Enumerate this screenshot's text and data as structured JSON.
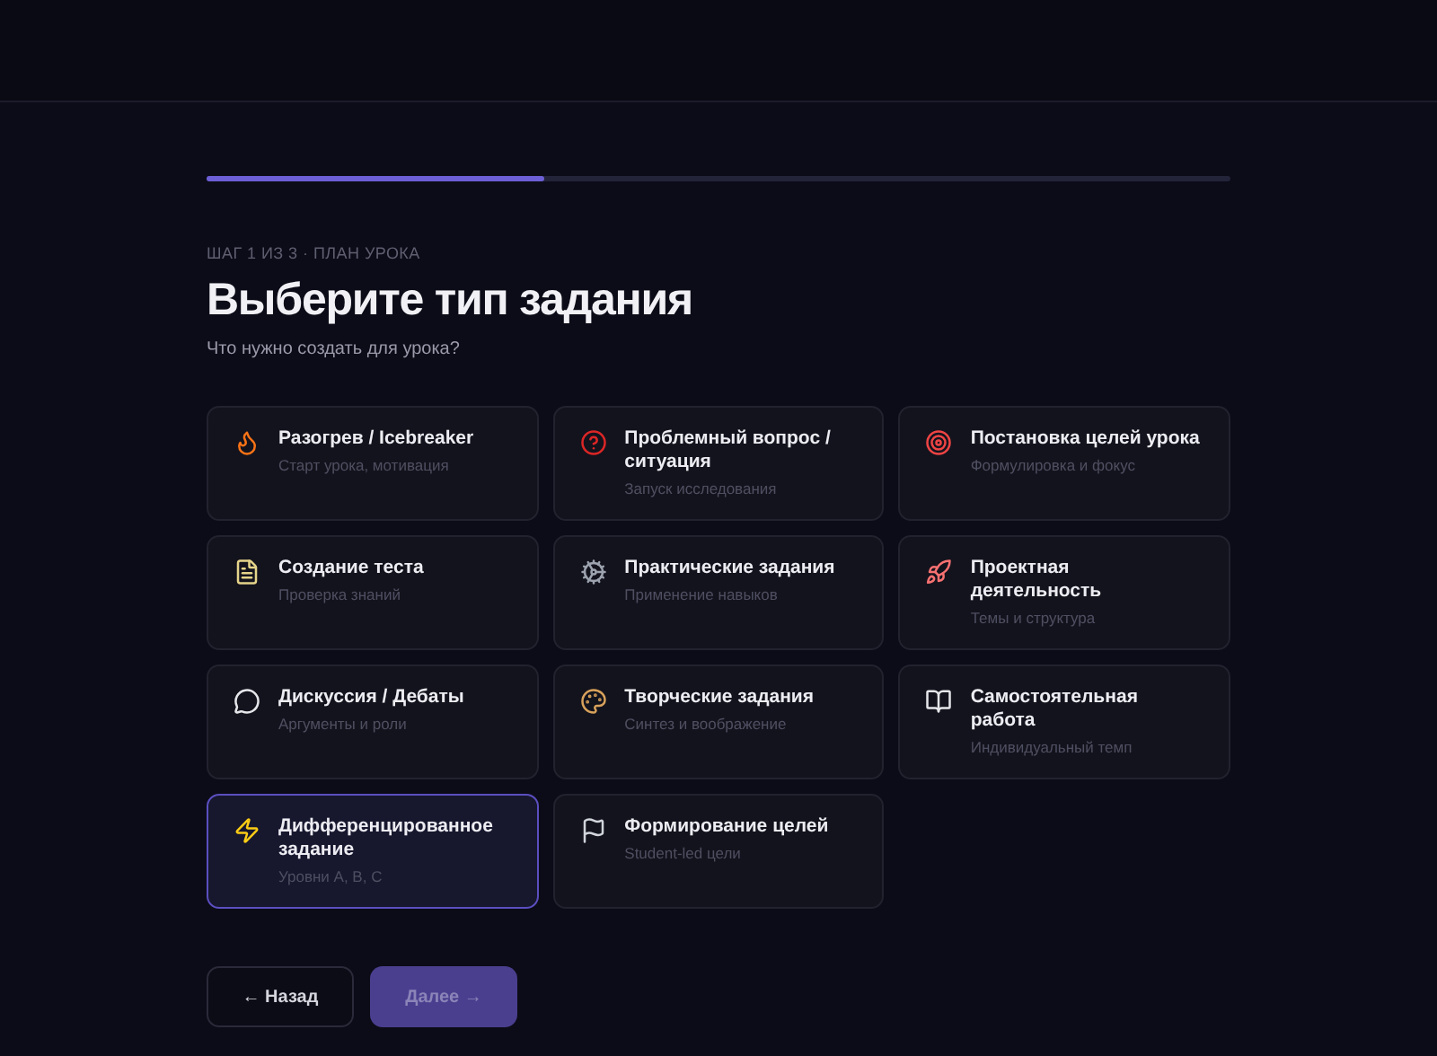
{
  "progress": {
    "level": 0.33
  },
  "step_label": "ШАГ 1 ИЗ 3 · ПЛАН УРОКА",
  "title": "Выберите тип задания",
  "subtitle": "Что нужно создать для урока?",
  "cards": [
    {
      "title": "Разогрев / Icebreaker",
      "description": "Старт урока, мотивация",
      "selected": false
    },
    {
      "title": "Проблемный вопрос / ситуация",
      "description": "Запуск исследования",
      "selected": false
    },
    {
      "title": "Постановка целей урока",
      "description": "Формулировка и фокус",
      "selected": false
    },
    {
      "title": "Создание теста",
      "description": "Проверка знаний",
      "selected": false
    },
    {
      "title": "Практические задания",
      "description": "Применение навыков",
      "selected": false
    },
    {
      "title": "Проектная деятельность",
      "description": "Темы и структура",
      "selected": false
    },
    {
      "title": "Дискуссия / Дебаты",
      "description": "Аргументы и роли",
      "selected": false
    },
    {
      "title": "Творческие задания",
      "description": "Синтез и воображение",
      "selected": false
    },
    {
      "title": "Самостоятельная работа",
      "description": "Индивидуальный темп",
      "selected": false
    },
    {
      "title": "Дифференцированное задание",
      "description": "Уровни A, B, C",
      "selected": true
    },
    {
      "title": "Формирование целей",
      "description": "Student-led цели",
      "selected": false
    }
  ],
  "buttons": {
    "back": {
      "label": "← Назад"
    },
    "next": {
      "label": "Далее →",
      "disabled": true
    }
  }
}
